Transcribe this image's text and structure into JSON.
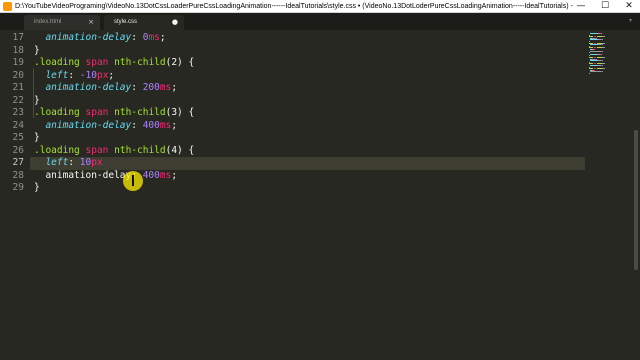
{
  "window": {
    "title": "D:\\YouTubeVideoPrograming\\VideoNo.13DotCssLoaderPureCssLoadingAnimation------IdealTutorials\\style.css • (VideoNo.13DotLoderPureCssLoadingAnimation-----IdealTutorials) - Sublime Text (UNREGISTERED)",
    "minimize_glyph": "—",
    "maximize_glyph": "☐",
    "close_glyph": "✕"
  },
  "tabs": [
    {
      "label": "index.html",
      "close_glyph": "×",
      "active": false
    },
    {
      "label": "style.css",
      "close_glyph": "●",
      "active": true
    }
  ],
  "tab_overflow_glyph": "▾",
  "editor": {
    "active_line": 27,
    "lines": [
      {
        "n": "17",
        "tokens": [
          {
            "t": "  ",
            "c": "plain"
          },
          {
            "t": "animation-delay",
            "c": "prop"
          },
          {
            "t": ": ",
            "c": "punc"
          },
          {
            "t": "0",
            "c": "num"
          },
          {
            "t": "ms",
            "c": "unit"
          },
          {
            "t": ";",
            "c": "punc"
          }
        ]
      },
      {
        "n": "18",
        "tokens": [
          {
            "t": "}",
            "c": "punc"
          }
        ]
      },
      {
        "n": "19",
        "tokens": [
          {
            "t": ".loading",
            "c": "sel"
          },
          {
            "t": " ",
            "c": "plain"
          },
          {
            "t": "span",
            "c": "tag"
          },
          {
            "t": " ",
            "c": "plain"
          },
          {
            "t": "nth-child",
            "c": "sel"
          },
          {
            "t": "(2) {",
            "c": "punc"
          }
        ]
      },
      {
        "n": "20",
        "tokens": [
          {
            "t": "  ",
            "c": "plain"
          },
          {
            "t": "left",
            "c": "prop"
          },
          {
            "t": ": ",
            "c": "punc"
          },
          {
            "t": "-10",
            "c": "num"
          },
          {
            "t": "px",
            "c": "unit"
          },
          {
            "t": ";",
            "c": "punc"
          }
        ]
      },
      {
        "n": "21",
        "tokens": [
          {
            "t": "  ",
            "c": "plain"
          },
          {
            "t": "animation-delay",
            "c": "prop"
          },
          {
            "t": ": ",
            "c": "punc"
          },
          {
            "t": "200",
            "c": "num"
          },
          {
            "t": "ms",
            "c": "unit"
          },
          {
            "t": ";",
            "c": "punc"
          }
        ]
      },
      {
        "n": "22",
        "tokens": [
          {
            "t": "}",
            "c": "punc"
          }
        ]
      },
      {
        "n": "23",
        "tokens": [
          {
            "t": ".loading",
            "c": "sel"
          },
          {
            "t": " ",
            "c": "plain"
          },
          {
            "t": "span",
            "c": "tag"
          },
          {
            "t": " ",
            "c": "plain"
          },
          {
            "t": "nth-child",
            "c": "sel"
          },
          {
            "t": "(3) {",
            "c": "punc"
          }
        ]
      },
      {
        "n": "24",
        "tokens": [
          {
            "t": "  ",
            "c": "plain"
          },
          {
            "t": "animation-delay",
            "c": "prop"
          },
          {
            "t": ": ",
            "c": "punc"
          },
          {
            "t": "400",
            "c": "num"
          },
          {
            "t": "ms",
            "c": "unit"
          },
          {
            "t": ";",
            "c": "punc"
          }
        ]
      },
      {
        "n": "25",
        "tokens": [
          {
            "t": "}",
            "c": "punc"
          }
        ]
      },
      {
        "n": "26",
        "tokens": [
          {
            "t": ".loading",
            "c": "sel"
          },
          {
            "t": " ",
            "c": "plain"
          },
          {
            "t": "span",
            "c": "tag"
          },
          {
            "t": " ",
            "c": "plain"
          },
          {
            "t": "nth-child",
            "c": "sel"
          },
          {
            "t": "(4) {",
            "c": "punc"
          }
        ]
      },
      {
        "n": "27",
        "tokens": [
          {
            "t": "  ",
            "c": "plain"
          },
          {
            "t": "left",
            "c": "prop"
          },
          {
            "t": ": ",
            "c": "punc"
          },
          {
            "t": "10",
            "c": "num"
          },
          {
            "t": "px",
            "c": "unit"
          }
        ]
      },
      {
        "n": "28",
        "tokens": [
          {
            "t": "  ",
            "c": "plain"
          },
          {
            "t": "animation-delay",
            "c": "plain"
          },
          {
            "t": ": ",
            "c": "punc"
          },
          {
            "t": "400",
            "c": "num"
          },
          {
            "t": "ms",
            "c": "unit"
          },
          {
            "t": ";",
            "c": "punc"
          }
        ]
      },
      {
        "n": "29",
        "tokens": [
          {
            "t": "}",
            "c": "punc"
          }
        ]
      }
    ]
  },
  "theme": {
    "background": "#272822",
    "line_highlight": "#3e3d32",
    "selector": "#a6e22e",
    "tag": "#f92672",
    "property": "#66d9ef",
    "number": "#ae81ff",
    "mouse_highlight": "#ffec00"
  },
  "icons": {
    "app": "sublime-text-icon",
    "pointer": "text-cursor-icon"
  }
}
